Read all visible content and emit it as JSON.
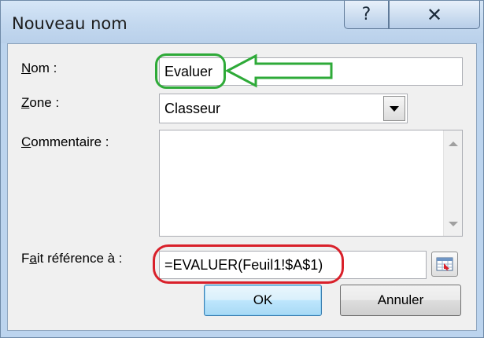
{
  "window": {
    "title": "Nouveau nom",
    "help_glyph": "?",
    "close_glyph": "✕"
  },
  "form": {
    "name_label_key": "N",
    "name_label_rest": "om :",
    "name_value": "Evaluer",
    "scope_label_key": "Z",
    "scope_label_rest": "one :",
    "scope_value": "Classeur",
    "comment_label_key": "C",
    "comment_label_rest": "ommentaire :",
    "comment_value": "",
    "ref_label_pre": "F",
    "ref_label_key": "a",
    "ref_label_rest": "it référence à :",
    "ref_value": "=EVALUER(Feuil1!$A$1)"
  },
  "buttons": {
    "ok": "OK",
    "cancel": "Annuler"
  },
  "annotations": {
    "name_highlight_color": "#2eaa38",
    "ref_highlight_color": "#d9202a"
  },
  "icons": [
    "help-icon",
    "close-icon",
    "dropdown-arrow-icon",
    "scroll-up-icon",
    "scroll-down-icon",
    "range-select-icon",
    "arrow-icon"
  ]
}
